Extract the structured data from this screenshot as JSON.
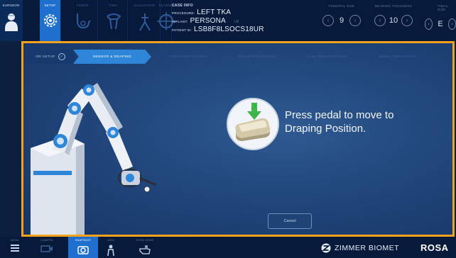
{
  "top_tabs": [
    {
      "label": "SURGEON",
      "icon": "surgeon-icon"
    },
    {
      "label": "SETUP",
      "icon": "gear-icon"
    },
    {
      "label": "FEMUR",
      "icon": "femur-icon"
    },
    {
      "label": "TIBIA",
      "icon": "tibia-icon"
    },
    {
      "label": "EVALUATION",
      "icon": "leg-evaluation-icon"
    },
    {
      "label": "PLANNING",
      "icon": "planning-target-icon"
    }
  ],
  "case_info": {
    "title": "CASE INFO",
    "procedure_key": "PROCEDURE:",
    "procedure": "LEFT TKA",
    "implant_key": "IMPLANT:",
    "implant": "PERSONA",
    "lr": "LR",
    "patient_key": "PATIENT ID:",
    "patient_id": "LSB8F8LSOCS18UR"
  },
  "steppers": [
    {
      "title": "FEMORAL SIZE",
      "value": "9"
    },
    {
      "title": "BEARING THICKNESS",
      "value": "10"
    },
    {
      "title": "TIBIAL SIZE",
      "value": "E"
    }
  ],
  "breadcrumb": [
    {
      "label": "OR SETUP",
      "state": "done"
    },
    {
      "label": "SENSOR & DRAPING",
      "state": "active"
    },
    {
      "label": "FLEX POSITIONING",
      "state": "future"
    },
    {
      "label": "ANKLE POSITIONING",
      "state": "future"
    },
    {
      "label": "FLEX REGISTRATION",
      "state": "future"
    },
    {
      "label": "BONE CHECKPOINT",
      "state": "future"
    }
  ],
  "prompt": {
    "line1": "Press pedal to move to",
    "line2": "Draping Position."
  },
  "cancel_label": "Cancel",
  "bottom_tabs": [
    {
      "label": "MENU",
      "icon": "menu-icon"
    },
    {
      "label": "CAMERA",
      "icon": "camera-icon"
    },
    {
      "label": "SNAPSHOT",
      "icon": "snapshot-icon"
    },
    {
      "label": "IDEA",
      "icon": "idea-person-icon"
    },
    {
      "label": "ROSA HOME",
      "icon": "hand-pointer-icon"
    }
  ],
  "brand": {
    "name": "ZIMMER BIOMET",
    "product": "ROSA"
  },
  "colors": {
    "accent_orange": "#f2a31b",
    "active_blue": "#1f6fcf",
    "topbar_bg": "#081a3c",
    "green_arrow": "#3db54a"
  }
}
